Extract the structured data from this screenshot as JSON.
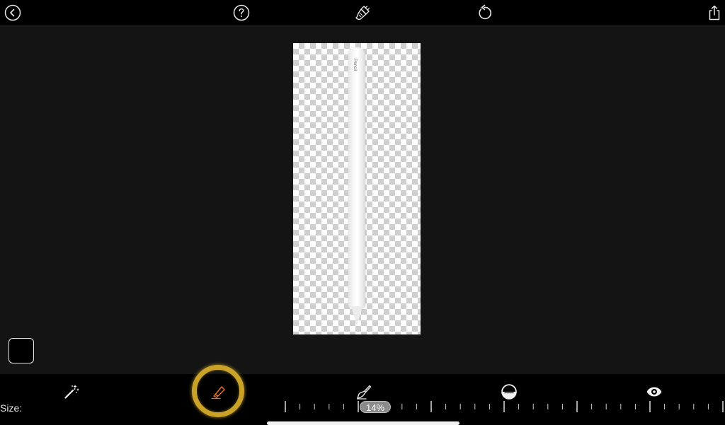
{
  "topbar": {
    "icons": [
      "back-icon",
      "help-icon",
      "brush-icon",
      "undo-icon",
      "share-icon"
    ]
  },
  "canvas": {
    "brand_text": "Pencil",
    "background_color": "#141414",
    "checker_color": "#cfcfcf"
  },
  "tools": {
    "items": [
      "magic-wand-icon",
      "eraser-icon",
      "brush-icon",
      "contrast-icon",
      "eye-icon"
    ],
    "active": "eraser-icon",
    "active_color": "#e8702a",
    "highlight_color": "#c9a227"
  },
  "size": {
    "label": "Size:",
    "value_text": "14%",
    "value": 14
  }
}
